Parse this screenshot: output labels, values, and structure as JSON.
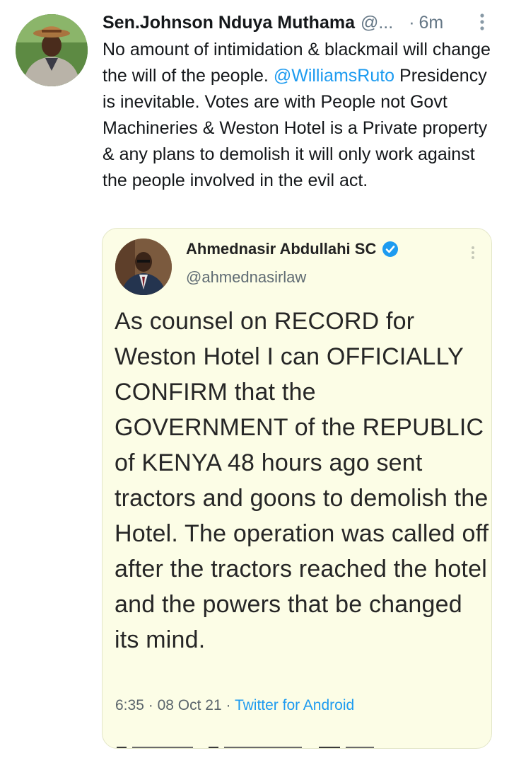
{
  "tweet": {
    "author_name": "Sen.Johnson Nduya Muthama",
    "author_handle": "@...",
    "separator": "·",
    "time": "6m",
    "text_before_mention": "No amount of intimidation & blackmail will change the will of the people.",
    "mention": "@WilliamsRuto",
    "text_after_mention": "Presidency is inevitable. Votes are with People not Govt Machineries & Weston Hotel is a Private property & any plans to demolish it will only work against the people involved in the evil act.",
    "avatar_icon": "profile-photo",
    "more_icon": "vertical-dots-icon"
  },
  "quoted": {
    "author_name": "Ahmednasir Abdullahi SC",
    "author_handle": "@ahmednasirlaw",
    "verified_icon": "verified-badge-icon",
    "text": "As counsel on RECORD for Weston Hotel I can OFFICIALLY CONFIRM that the GOVERNMENT of the REPUBLIC of KENYA 48 hours ago sent tractors and goons to demolish the Hotel. The operation was called off after the tractors reached the hotel and the powers that be changed its mind.",
    "time": "6:35",
    "date": "08 Oct 21",
    "separator": "·",
    "source": "Twitter for Android"
  },
  "colors": {
    "link": "#1d9bf0",
    "muted": "#657786",
    "card_background": "#fcfde6"
  }
}
